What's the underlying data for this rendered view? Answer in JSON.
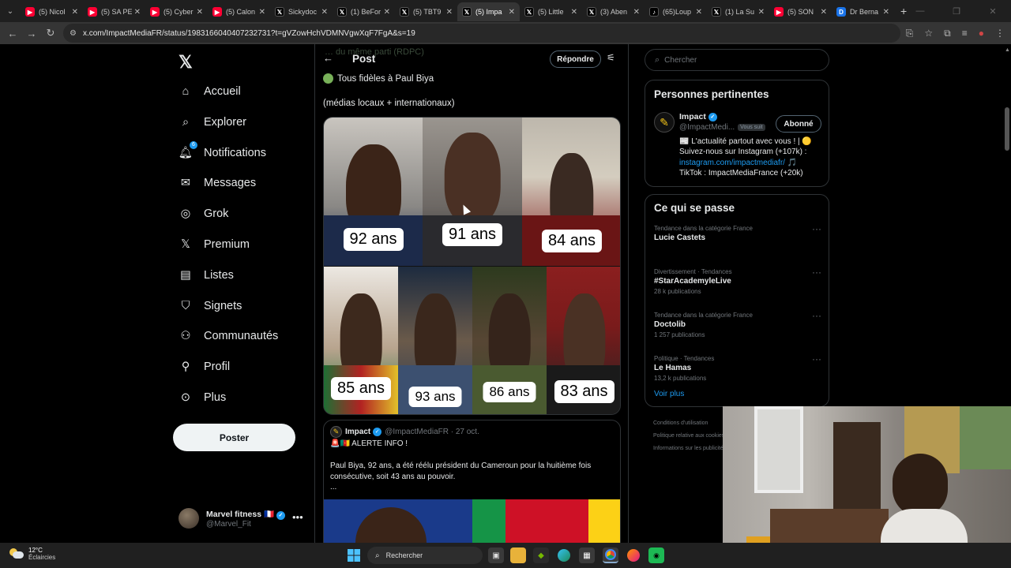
{
  "browser": {
    "tabs": [
      {
        "title": "(5) Nicol",
        "fav": "yt"
      },
      {
        "title": "(5) SA PE",
        "fav": "yt"
      },
      {
        "title": "(5) Cyber",
        "fav": "yt"
      },
      {
        "title": "(5) Calon",
        "fav": "yt"
      },
      {
        "title": "Sickydoc",
        "fav": "x"
      },
      {
        "title": "(1) BeFor",
        "fav": "x"
      },
      {
        "title": "(5) TBT9",
        "fav": "x"
      },
      {
        "title": "(5) Impa",
        "fav": "x",
        "active": true
      },
      {
        "title": "(5) Little",
        "fav": "x"
      },
      {
        "title": "(3) Aben",
        "fav": "x"
      },
      {
        "title": "(65)Loup",
        "fav": "tt"
      },
      {
        "title": "(1) La Su",
        "fav": "x"
      },
      {
        "title": "(5) SON",
        "fav": "yt"
      },
      {
        "title": "Dr Berna",
        "fav": "doc"
      }
    ],
    "url": "x.com/ImpactMediaFR/status/1983166040407232731?t=gVZowHchVDMNVgwXqF7FgA&s=19"
  },
  "nav": {
    "items": [
      {
        "label": "Accueil",
        "icon": "home-icon"
      },
      {
        "label": "Explorer",
        "icon": "search-icon"
      },
      {
        "label": "Notifications",
        "icon": "bell-icon",
        "badge": "6"
      },
      {
        "label": "Messages",
        "icon": "mail-icon"
      },
      {
        "label": "Grok",
        "icon": "grok-icon"
      },
      {
        "label": "Premium",
        "icon": "x-logo-icon"
      },
      {
        "label": "Listes",
        "icon": "list-icon"
      },
      {
        "label": "Signets",
        "icon": "bookmark-icon"
      },
      {
        "label": "Communautés",
        "icon": "people-icon"
      },
      {
        "label": "Profil",
        "icon": "person-icon"
      },
      {
        "label": "Plus",
        "icon": "more-circle-icon"
      }
    ],
    "post_button": "Poster",
    "account": {
      "name": "Marvel fitness",
      "flag": "🇫🇷",
      "handle": "@Marvel_Fit"
    }
  },
  "post": {
    "header_title": "Post",
    "ghost_line": "… du même parti (RDPC)",
    "reply_button": "Répondre",
    "line1": "Tous fidèles à Paul Biya",
    "line2": "(médias locaux + internationaux)",
    "ages": [
      "92 ans",
      "91 ans",
      "84 ans",
      "85 ans",
      "93 ans",
      "86 ans",
      "83 ans"
    ],
    "quote": {
      "name": "Impact",
      "handle": "@ImpactMediaFR · 27 oct.",
      "alert": "🚨🇨🇲 ALERTE INFO !",
      "text": "Paul Biya, 92 ans, a été réélu président du Cameroun pour la huitième fois consécutive, soit 43 ans au pouvoir.",
      "more": "..."
    }
  },
  "right": {
    "search_placeholder": "Chercher",
    "relevant_title": "Personnes pertinentes",
    "person": {
      "name": "Impact",
      "handle": "@ImpactMedi...",
      "follows_you": "Vous suit",
      "button": "Abonné",
      "bio1": "📰 L'actualité partout avec vous ! | 🟡",
      "bio2": "Suivez-nous sur Instagram (+107k) :",
      "bio_link": "instagram.com/impactmediafr/",
      "bio3": " 🎵",
      "bio4": "TikTok : ImpactMediaFrance (+20k)"
    },
    "happening_title": "Ce qui se passe",
    "trends": [
      {
        "category": "Tendance dans la catégorie France",
        "name": "Lucie Castets",
        "count": ""
      },
      {
        "category": "Divertissement · Tendances",
        "name": "#StarAcademyleLive",
        "count": "28 k publications"
      },
      {
        "category": "Tendance dans la catégorie France",
        "name": "Doctolib",
        "count": "1 257 publications"
      },
      {
        "category": "Politique · Tendances",
        "name": "Le Hamas",
        "count": "13,2 k publications"
      }
    ],
    "see_more": "Voir plus",
    "footer": [
      "Conditions d'utilisation",
      "Politique relative aux cookies",
      "Informations sur les publicités"
    ]
  },
  "taskbar": {
    "temp": "12°C",
    "weather": "Éclaircies",
    "search": "Rechercher"
  }
}
